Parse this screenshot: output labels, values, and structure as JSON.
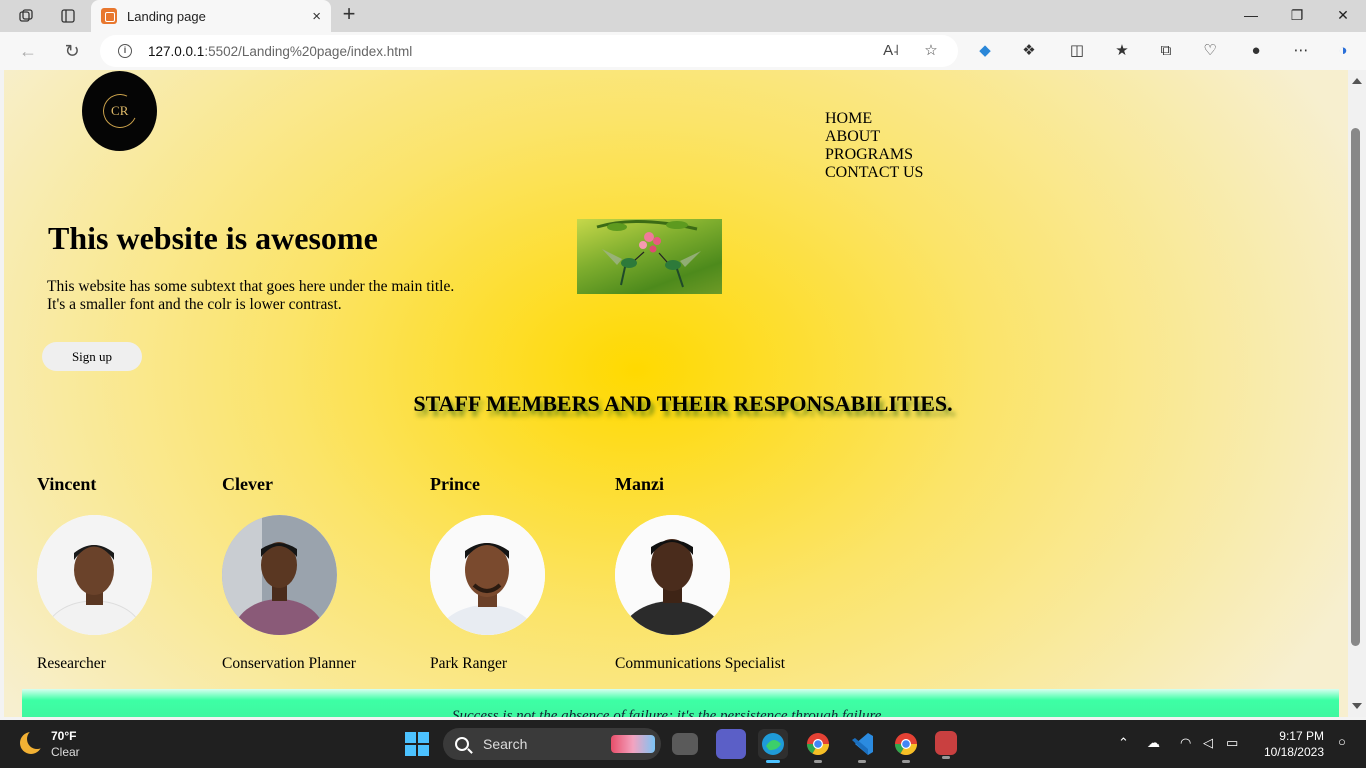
{
  "browser": {
    "tab_title": "Landing page",
    "tab_close": "×",
    "new_tab": "+",
    "url_host": "127.0.0.1",
    "url_path": ":5502/Landing%20page/index.html"
  },
  "page": {
    "logo_text": "CR",
    "nav": [
      "HOME",
      "ABOUT",
      "PROGRAMS",
      "CONTACT US"
    ],
    "hero": {
      "title": "This website is awesome",
      "subtext_line1": "This website has some subtext that goes here under the main title.",
      "subtext_line2": "It's a smaller font and the colr is lower contrast.",
      "signup_label": "Sign up"
    },
    "staff_heading": "STAFF MEMBERS AND THEIR RESPONSABILITIES.",
    "staff": [
      {
        "name": "Vincent",
        "role": "Researcher",
        "shirt": "#f2f2f2"
      },
      {
        "name": "Clever",
        "role": "Conservation Planner",
        "shirt": "#8a5a78"
      },
      {
        "name": "Prince",
        "role": "Park Ranger",
        "shirt": "#e8ecf2"
      },
      {
        "name": "Manzi",
        "role": "Communications Specialist",
        "shirt": "#2b2b2b"
      }
    ],
    "footer_text": "Success is not the absence of failure; it's the persistence through failure."
  },
  "taskbar": {
    "weather_temp": "70°F",
    "weather_condition": "Clear",
    "search_placeholder": "Search",
    "time": "9:17 PM",
    "date": "10/18/2023"
  },
  "colors": {
    "page_center": "#ffd900",
    "page_edge": "#f7efcf",
    "footer_band": "#3dffa5",
    "accent_blue": "#4cc2ff"
  }
}
